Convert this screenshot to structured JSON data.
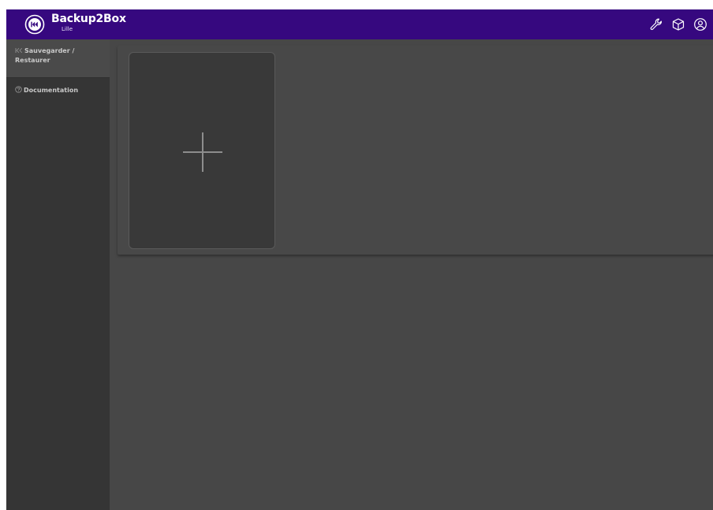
{
  "header": {
    "app_title": "Backup2Box",
    "subtitle": "Lille",
    "brand_color": "#36087f",
    "logo_icon": "rewind-icon",
    "actions": [
      {
        "icon": "wrench-icon"
      },
      {
        "icon": "package-icon"
      },
      {
        "icon": "user-circle-icon"
      }
    ]
  },
  "sidebar": {
    "items": [
      {
        "label": "Sauvegarder /",
        "label_line2": "Restaurer",
        "icon": "skip-icon",
        "active": true
      },
      {
        "label": "Documentation",
        "icon": "help-circle-icon",
        "active": false
      }
    ]
  },
  "main": {
    "add_card": {
      "icon": "plus-icon"
    }
  }
}
